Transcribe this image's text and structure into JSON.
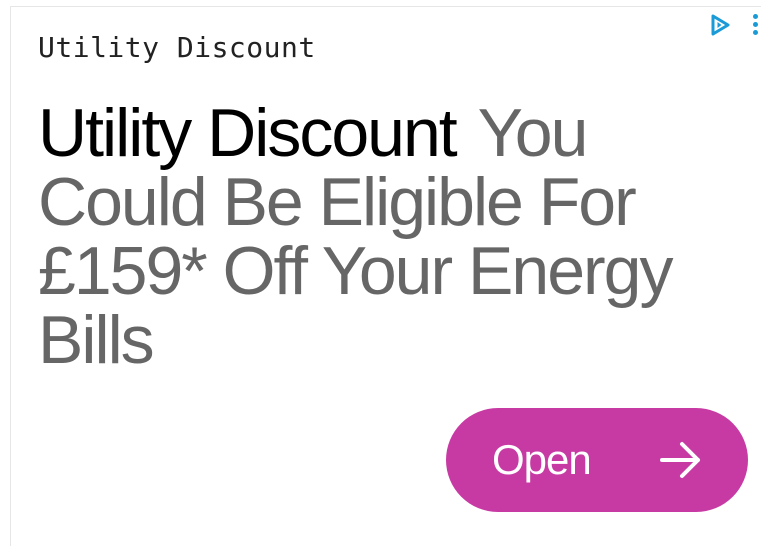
{
  "ad": {
    "label": "Utility Discount",
    "headline_title": "Utility Discount",
    "headline_body": "You Could Be Eligible For £159* Off Your Energy Bills",
    "cta_label": "Open"
  },
  "icons": {
    "adchoices": "adchoices-icon",
    "options": "kebab-menu-icon",
    "cta_arrow": "arrow-right-icon"
  },
  "colors": {
    "cta_background": "#c73aa3",
    "headline_title": "#000000",
    "headline_body": "#666666",
    "icon_accent": "#1a9bd7"
  }
}
